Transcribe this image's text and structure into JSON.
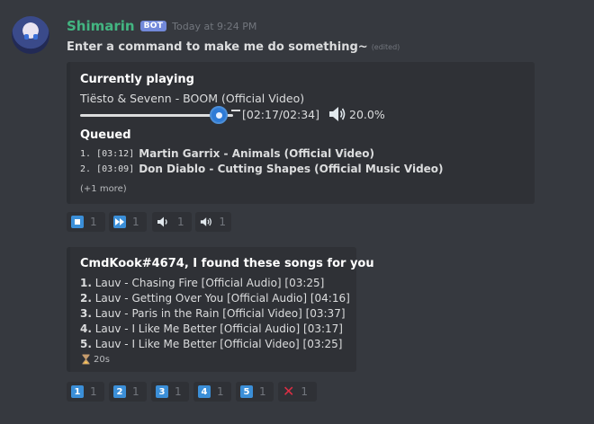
{
  "message": {
    "username": "Shimarin",
    "bot_tag": "BOT",
    "timestamp": "Today at 9:24 PM",
    "content": "Enter a command to make me do something~",
    "edited": "(edited)"
  },
  "player_embed": {
    "title": "Currently playing",
    "track": "Tiësto & Sevenn - BOOM (Official Video)",
    "progress_fraction": 0.9,
    "time": "[02:17/02:34]",
    "speaker_icon": "speaker-icon",
    "volume": "20.0%",
    "queue_title": "Queued",
    "queue": [
      {
        "num": "1.",
        "dur": "[03:12]",
        "title": "Martin Garrix - Animals (Official Video)"
      },
      {
        "num": "2.",
        "dur": "[03:09]",
        "title": "Don Diablo - Cutting Shapes (Official Music Video)"
      }
    ],
    "more": "(+1 more)"
  },
  "player_reactions": [
    {
      "icon": "stop-icon",
      "count": "1"
    },
    {
      "icon": "fast-forward-icon",
      "count": "1"
    },
    {
      "icon": "volume-down-icon",
      "count": "1"
    },
    {
      "icon": "volume-up-icon",
      "count": "1"
    }
  ],
  "search_embed": {
    "title": "CmdKook#4674, I found these songs for you",
    "results": [
      {
        "num": "1.",
        "text": "Lauv - Chasing Fire [Official Audio] [03:25]"
      },
      {
        "num": "2.",
        "text": "Lauv - Getting Over You [Official Audio] [04:16]"
      },
      {
        "num": "3.",
        "text": "Lauv - Paris in the Rain [Official Video] [03:37]"
      },
      {
        "num": "4.",
        "text": "Lauv - I Like Me Better [Official Audio] [03:17]"
      },
      {
        "num": "5.",
        "text": "Lauv - I Like Me Better [Official Video] [03:25]"
      }
    ],
    "timer_icon": "hourglass-icon",
    "timer": "20s"
  },
  "search_reactions": [
    {
      "icon": "keycap-1-icon",
      "key": "1",
      "count": "1"
    },
    {
      "icon": "keycap-2-icon",
      "key": "2",
      "count": "1"
    },
    {
      "icon": "keycap-3-icon",
      "key": "3",
      "count": "1"
    },
    {
      "icon": "keycap-4-icon",
      "key": "4",
      "count": "1"
    },
    {
      "icon": "keycap-5-icon",
      "key": "5",
      "count": "1"
    },
    {
      "icon": "cross-mark-icon",
      "count": "1"
    }
  ]
}
